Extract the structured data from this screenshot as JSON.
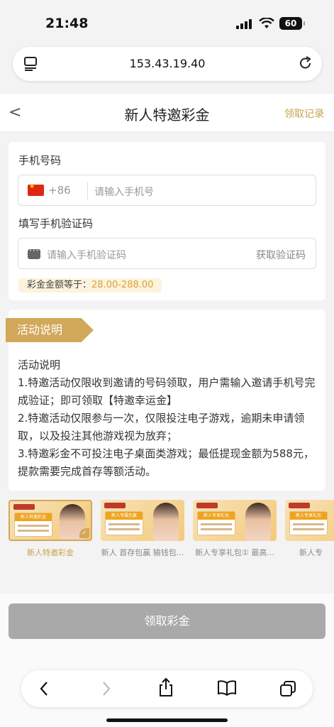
{
  "status_bar": {
    "time": "21:48",
    "battery": "60"
  },
  "browser": {
    "url": "153.43.19.40"
  },
  "header": {
    "back": "<",
    "title": "新人特邀彩金",
    "record_link": "领取记录"
  },
  "form": {
    "phone_label": "手机号码",
    "country_code": "+86",
    "phone_placeholder": "请输入手机号",
    "code_label": "填写手机验证码",
    "code_placeholder": "请输入手机验证码",
    "get_code": "获取验证码",
    "amount_label": "彩金金额等于：",
    "amount_range": "28.00-288.00"
  },
  "activity": {
    "ribbon": "活动说明",
    "text": "活动说明\n1.特邀活动仅限收到邀请的号码领取，用户需输入邀请手机号完成验证；即可领取【特邀幸运金】\n2.特邀活动仅限参与一次，仅限投注电子游戏，逾期未申请领取，以及投注其他游戏视为放弃；\n3.特邀彩金不可投注电子桌面类游戏；最低提现金额为588元，提款需要完成首存等额活动。"
  },
  "banners": [
    {
      "label": "新人特邀彩金",
      "card_title": "新人特邀彩金",
      "selected": true
    },
    {
      "label": "新人 首存包赢 输钱包...",
      "card_title": "新人专属包赢",
      "selected": false
    },
    {
      "label": "新人专享礼包① 最高...",
      "card_title": "新人专享礼包",
      "selected": false
    },
    {
      "label": "新人专",
      "card_title": "新人专享礼包",
      "selected": false
    }
  ],
  "claim_button": "领取彩金",
  "colors": {
    "gold": "#c9a24c",
    "ribbon": "#d2a85a",
    "amount": "#d9a23a",
    "button_disabled": "#a9a9a9"
  },
  "icons": [
    "reader-icon",
    "reload-icon",
    "back-icon",
    "forward-icon",
    "share-icon",
    "bookmarks-icon",
    "tabs-icon"
  ]
}
